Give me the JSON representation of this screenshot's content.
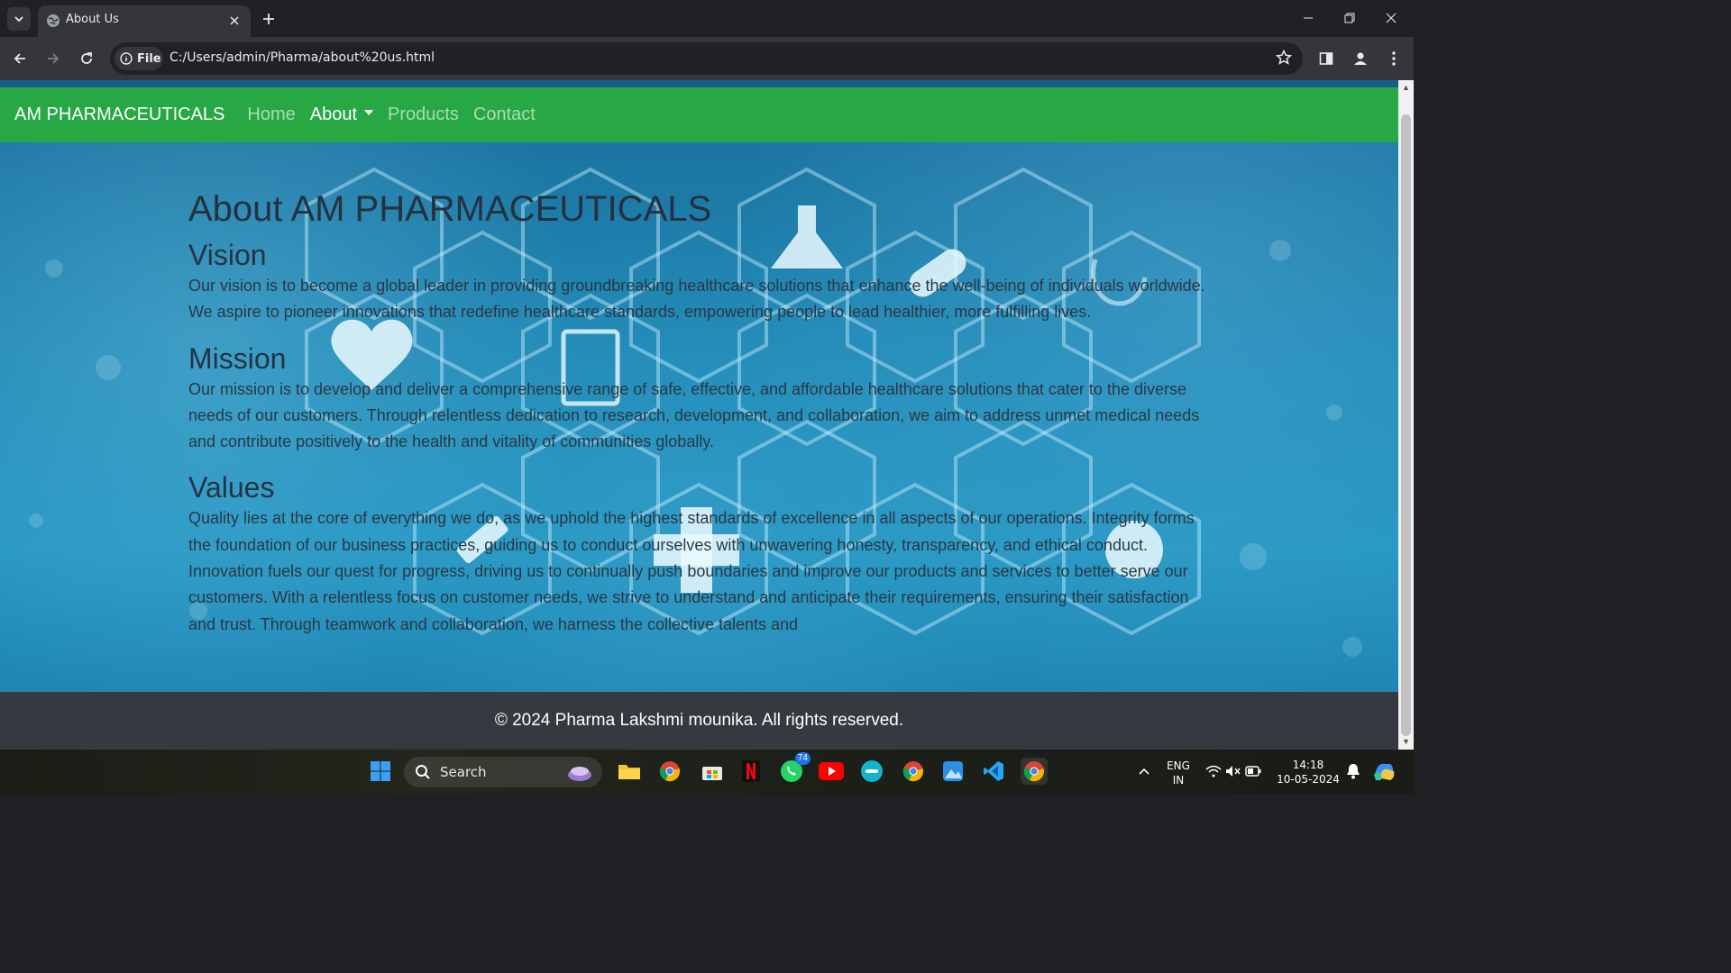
{
  "browser": {
    "tab_title": "About Us",
    "site_chip_label": "File",
    "url": "C:/Users/admin/Pharma/about%20us.html"
  },
  "navbar": {
    "brand": "AM PHARMACEUTICALS",
    "links": [
      {
        "label": "Home",
        "active": false
      },
      {
        "label": "About",
        "active": true,
        "dropdown": true
      },
      {
        "label": "Products",
        "active": false
      },
      {
        "label": "Contact",
        "active": false
      }
    ]
  },
  "content": {
    "title": "About AM PHARMACEUTICALS",
    "vision_heading": "Vision",
    "vision_text": "Our vision is to become a global leader in providing groundbreaking healthcare solutions that enhance the well-being of individuals worldwide. We aspire to pioneer innovations that redefine healthcare standards, empowering people to lead healthier, more fulfilling lives.",
    "mission_heading": "Mission",
    "mission_text": "Our mission is to develop and deliver a comprehensive range of safe, effective, and affordable healthcare solutions that cater to the diverse needs of our customers. Through relentless dedication to research, development, and collaboration, we aim to address unmet medical needs and contribute positively to the health and vitality of communities globally.",
    "values_heading": "Values",
    "values_text": "Quality lies at the core of everything we do, as we uphold the highest standards of excellence in all aspects of our operations. Integrity forms the foundation of our business practices, guiding us to conduct ourselves with unwavering honesty, transparency, and ethical conduct. Innovation fuels our quest for progress, driving us to continually push boundaries and improve our products and services to better serve our customers. With a relentless focus on customer needs, we strive to understand and anticipate their requirements, ensuring their satisfaction and trust. Through teamwork and collaboration, we harness the collective talents and"
  },
  "footer": {
    "text": "© 2024 Pharma Lakshmi mounika. All rights reserved."
  },
  "taskbar": {
    "search_label": "Search",
    "whatsapp_badge": "74",
    "lang_line1": "ENG",
    "lang_line2": "IN",
    "time": "14:18",
    "date": "10-05-2024"
  },
  "colors": {
    "navbar": "#28a745",
    "footer": "#343a40",
    "chrome_dark": "#202124",
    "chrome_toolbar": "#35363a"
  }
}
